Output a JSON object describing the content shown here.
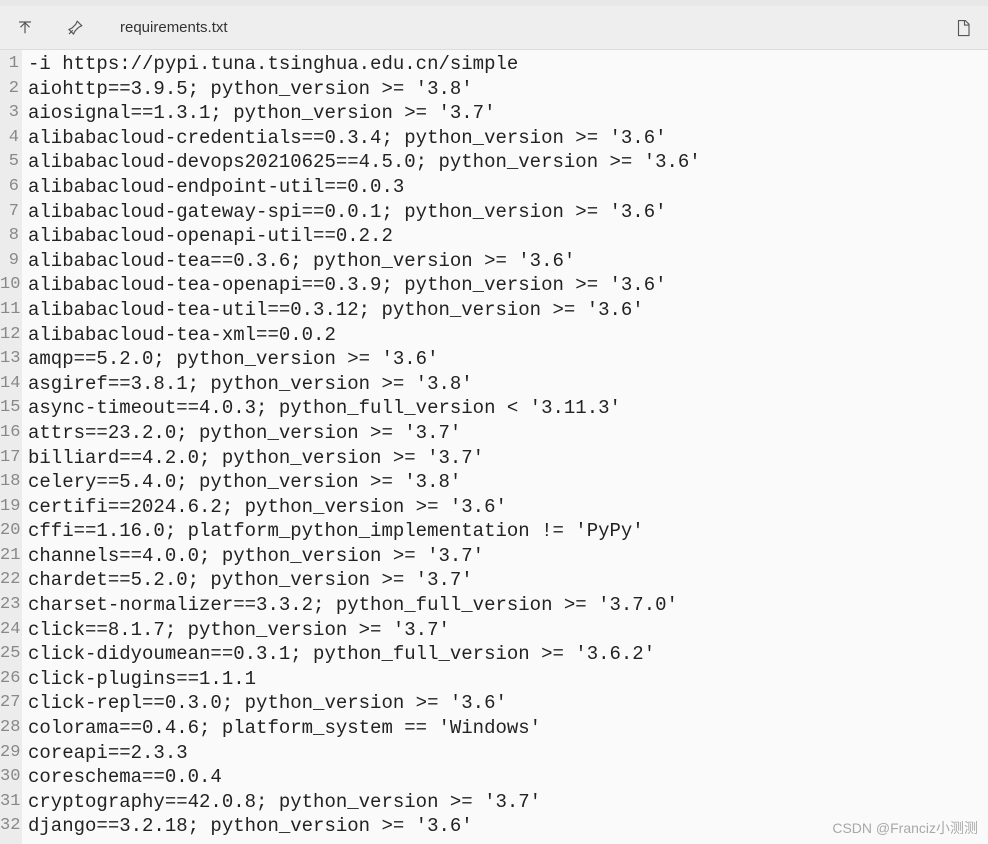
{
  "toolbar": {
    "filename": "requirements.txt"
  },
  "lines": [
    "-i https://pypi.tuna.tsinghua.edu.cn/simple",
    "aiohttp==3.9.5; python_version >= '3.8'",
    "aiosignal==1.3.1; python_version >= '3.7'",
    "alibabacloud-credentials==0.3.4; python_version >= '3.6'",
    "alibabacloud-devops20210625==4.5.0; python_version >= '3.6'",
    "alibabacloud-endpoint-util==0.0.3",
    "alibabacloud-gateway-spi==0.0.1; python_version >= '3.6'",
    "alibabacloud-openapi-util==0.2.2",
    "alibabacloud-tea==0.3.6; python_version >= '3.6'",
    "alibabacloud-tea-openapi==0.3.9; python_version >= '3.6'",
    "alibabacloud-tea-util==0.3.12; python_version >= '3.6'",
    "alibabacloud-tea-xml==0.0.2",
    "amqp==5.2.0; python_version >= '3.6'",
    "asgiref==3.8.1; python_version >= '3.8'",
    "async-timeout==4.0.3; python_full_version < '3.11.3'",
    "attrs==23.2.0; python_version >= '3.7'",
    "billiard==4.2.0; python_version >= '3.7'",
    "celery==5.4.0; python_version >= '3.8'",
    "certifi==2024.6.2; python_version >= '3.6'",
    "cffi==1.16.0; platform_python_implementation != 'PyPy'",
    "channels==4.0.0; python_version >= '3.7'",
    "chardet==5.2.0; python_version >= '3.7'",
    "charset-normalizer==3.3.2; python_full_version >= '3.7.0'",
    "click==8.1.7; python_version >= '3.7'",
    "click-didyoumean==0.3.1; python_full_version >= '3.6.2'",
    "click-plugins==1.1.1",
    "click-repl==0.3.0; python_version >= '3.6'",
    "colorama==0.4.6; platform_system == 'Windows'",
    "coreapi==2.3.3",
    "coreschema==0.0.4",
    "cryptography==42.0.8; python_version >= '3.7'",
    "django==3.2.18; python_version >= '3.6'"
  ],
  "watermark": "CSDN @Franciz小测测"
}
